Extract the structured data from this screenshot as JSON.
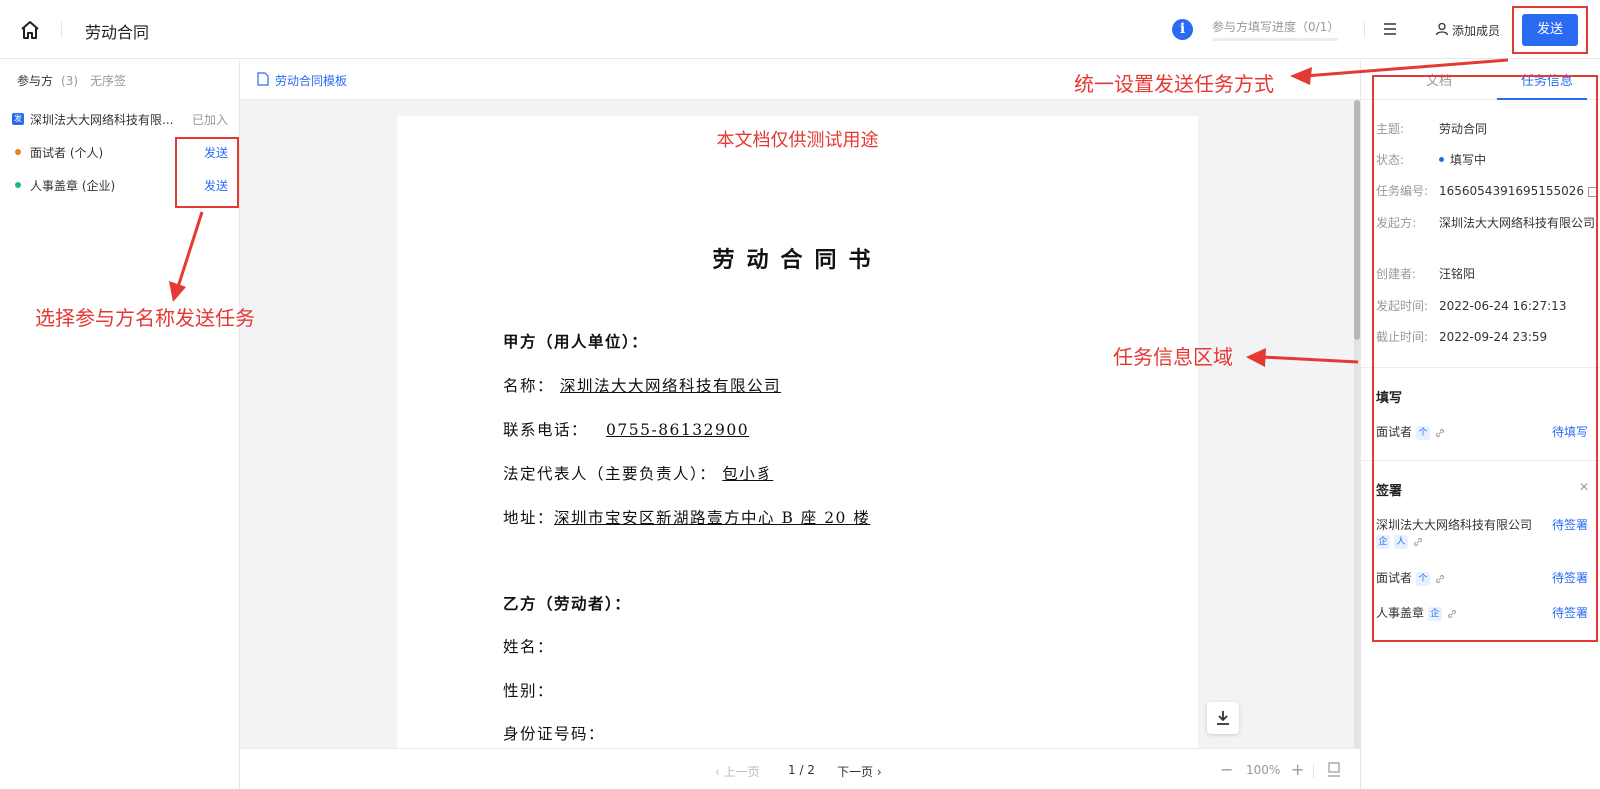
{
  "header": {
    "title": "劳动合同",
    "progress_label": "参与方填写进度（0/1）",
    "progress_value": 0,
    "add_member": "添加成员",
    "send": "发送",
    "info_glyph": "i"
  },
  "participants": {
    "tab_label": "参与方",
    "tab_count": "(3)",
    "tab_unordered": "无序签",
    "org": {
      "badge": "发",
      "name": "深圳法大大网络科技有限...",
      "status": "已加入"
    },
    "rows": [
      {
        "name": "面试者 (个人)",
        "action": "发送",
        "dot": "#f07d1e"
      },
      {
        "name": "人事盖章 (企业)",
        "action": "发送",
        "dot": "#1fb68c"
      }
    ]
  },
  "doc": {
    "template": "劳动合同模板",
    "watermark": "本文档仅供测试用途",
    "title": "劳动合同书",
    "party_a_heading": "甲方（用人单位）：",
    "name_label": "名称：",
    "name_value": "深圳法大大网络科技有限公司",
    "phone_label": "联系电话：",
    "phone_value": "0755-86132900",
    "rep_label": "法定代表人（主要负责人）：",
    "rep_value": "包小豸",
    "addr_label": "地址：",
    "addr_value": "深圳市宝安区新湖路壹方中心 B 座 20 楼",
    "party_b_heading": "乙方（劳动者）：",
    "b_name": "姓名：",
    "b_gender": "性别：",
    "b_id": "身份证号码："
  },
  "footer": {
    "prev": "‹ 上一页",
    "page": "1 / 2",
    "next": "下一页 ›",
    "zoom_minus": "−",
    "zoom": "100%",
    "zoom_plus": "+"
  },
  "right": {
    "tab_doc": "文档",
    "tab_task": "任务信息",
    "info": [
      {
        "label": "主题:",
        "value": "劳动合同"
      },
      {
        "label": "状态:",
        "value": "填写中"
      },
      {
        "label": "任务编号:",
        "value": "1656054391695155026"
      },
      {
        "label": "发起方:",
        "value": "深圳法大大网络科技有限公司"
      },
      {
        "label": "创建者:",
        "value": "汪铭阳"
      },
      {
        "label": "发起时间:",
        "value": "2022-06-24 16:27:13"
      },
      {
        "label": "截止时间:",
        "value": "2022-09-24 23:59"
      }
    ],
    "fill_title": "填写",
    "fill_rows": [
      {
        "name": "面试者",
        "status": "待填写",
        "chip": "个"
      }
    ],
    "sign_title": "签署",
    "collapse_glyph": "✕",
    "sign_rows": [
      {
        "name": "深圳法大大网络科技有限公司",
        "status": "待签署",
        "chip1": "企",
        "chip2": "人"
      },
      {
        "name": "面试者",
        "status": "待签署",
        "chip": "个"
      },
      {
        "name": "人事盖章",
        "status": "待签署",
        "chip": "企"
      }
    ]
  },
  "annotations": {
    "send_method": "统一设置发送任务方式",
    "select_participant": "选择参与方名称发送任务",
    "task_info_area": "任务信息区域"
  }
}
